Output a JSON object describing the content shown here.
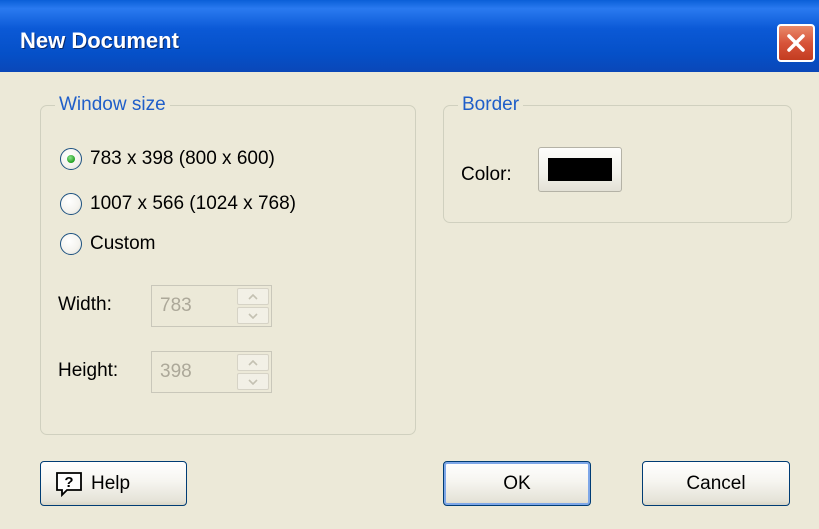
{
  "window": {
    "title": "New Document",
    "close_icon": "close-icon"
  },
  "window_size": {
    "legend": "Window size",
    "options": [
      {
        "label": "783 x 398 (800 x 600)",
        "selected": true
      },
      {
        "label": "1007 x 566 (1024 x 768)",
        "selected": false
      },
      {
        "label": "Custom",
        "selected": false
      }
    ],
    "width_label": "Width:",
    "width_value": "783",
    "height_label": "Height:",
    "height_value": "398"
  },
  "border": {
    "legend": "Border",
    "color_label": "Color:",
    "color_value": "#000000"
  },
  "buttons": {
    "help": "Help",
    "ok": "OK",
    "cancel": "Cancel"
  },
  "colors": {
    "titlebar": "#0a59d6",
    "dialog_bg": "#ece9d8",
    "legend_text": "#1f5ec9",
    "disabled_text": "#aca899"
  }
}
